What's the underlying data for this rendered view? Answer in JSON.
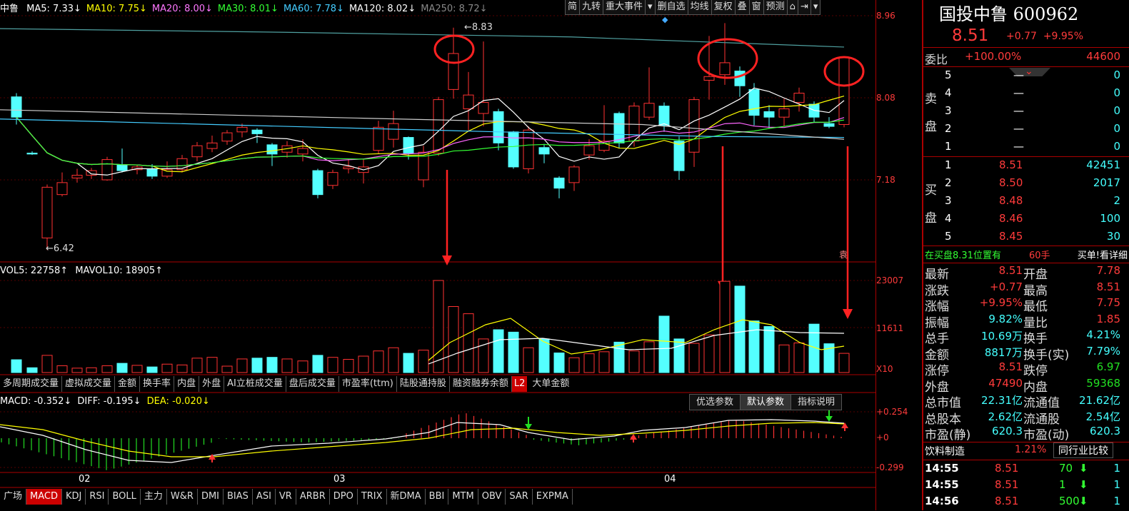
{
  "ma_legend": {
    "stock_prefix": "中鲁",
    "items": [
      {
        "text": "MA5: 7.33↓",
        "color": "#ffffff"
      },
      {
        "text": "MA10: 7.75↓",
        "color": "#ffff00"
      },
      {
        "text": "MA20: 8.00↓",
        "color": "#ff77ff"
      },
      {
        "text": "MA30: 8.01↓",
        "color": "#33ff33"
      },
      {
        "text": "MA60: 7.78↓",
        "color": "#44ccff"
      },
      {
        "text": "MA120: 8.02↓",
        "color": "#ffffff"
      },
      {
        "text": "MA250: 8.72↓",
        "color": "#888888"
      }
    ]
  },
  "toolbar": {
    "jian": "简",
    "jiuzhuan": "九转",
    "events": "重大事件",
    "dropdown": "▾",
    "del_fav": "删自选",
    "ma_line": "均线",
    "fuquan": "复权",
    "overlay": "叠",
    "window": "窗",
    "forecast": "预测",
    "lock": "🔒",
    "exit": "⇥",
    "more": "▾"
  },
  "price_axis": [
    "8.96",
    "8.08",
    "7.18"
  ],
  "price_annotations": {
    "high": "8.83",
    "low": "6.42"
  },
  "vol_legend": {
    "vol5": "VOL5: 22758↑",
    "mavol10": "MAVOL10: 18905↑"
  },
  "vol_axis": [
    "23007",
    "11611",
    "X10"
  ],
  "indicator_tabs": [
    "多周期成交量",
    "虚拟成交量",
    "金额",
    "换手率",
    "内盘",
    "外盘",
    "AI立桩成交量",
    "盘后成交量",
    "市盈率(ttm)",
    "陆股通持股",
    "融资融券余额"
  ],
  "l2_badge": "L2",
  "big_order_tab": "大单金额",
  "param_buttons": [
    "优选参数",
    "默认参数",
    "指标说明"
  ],
  "macd_legend": {
    "macd": "MACD: -0.352↓",
    "diff": "DIFF: -0.195↓",
    "dea": "DEA: -0.020↓"
  },
  "macd_axis": [
    "+0.254",
    "+0",
    "-0.299"
  ],
  "month_labels": [
    "02",
    "03",
    "04"
  ],
  "bottom_tabs": [
    "广场",
    "MACD",
    "KDJ",
    "RSI",
    "BOLL",
    "主力",
    "W&R",
    "DMI",
    "BIAS",
    "ASI",
    "VR",
    "ARBR",
    "DPO",
    "TRIX",
    "新DMA",
    "BBI",
    "MTM",
    "OBV",
    "SAR",
    "EXPMA"
  ],
  "vol_marker": "袁",
  "panel": {
    "name": "国投中鲁",
    "code": "600962",
    "price": "8.51",
    "change": "+0.77",
    "change_pct": "+9.95%",
    "weibi_label": "委比",
    "weibi_value": "+100.00%",
    "weibi_diff": "44600",
    "sell_label_1": "卖",
    "sell_label_2": "盘",
    "buy_label_1": "买",
    "buy_label_2": "盘",
    "sell": [
      {
        "lvl": "5",
        "price": "—",
        "vol": "0"
      },
      {
        "lvl": "4",
        "price": "—",
        "vol": "0"
      },
      {
        "lvl": "3",
        "price": "—",
        "vol": "0"
      },
      {
        "lvl": "2",
        "price": "—",
        "vol": "0"
      },
      {
        "lvl": "1",
        "price": "—",
        "vol": "0"
      }
    ],
    "buy": [
      {
        "lvl": "1",
        "price": "8.51",
        "vol": "42451"
      },
      {
        "lvl": "2",
        "price": "8.50",
        "vol": "2017"
      },
      {
        "lvl": "3",
        "price": "8.48",
        "vol": "2"
      },
      {
        "lvl": "4",
        "price": "8.46",
        "vol": "100"
      },
      {
        "lvl": "5",
        "price": "8.45",
        "vol": "30"
      }
    ],
    "position_note": "在买盘8.31位置有",
    "position_hands": "60手",
    "position_link": "买单!看详细",
    "stats": [
      {
        "l1": "最新",
        "v1": "8.51",
        "c1": "#ff3b3b",
        "l2": "开盘",
        "v2": "7.78",
        "c2": "#ff3b3b"
      },
      {
        "l1": "涨跌",
        "v1": "+0.77",
        "c1": "#ff3b3b",
        "l2": "最高",
        "v2": "8.51",
        "c2": "#ff3b3b"
      },
      {
        "l1": "涨幅",
        "v1": "+9.95%",
        "c1": "#ff3b3b",
        "l2": "最低",
        "v2": "7.75",
        "c2": "#ff3b3b"
      },
      {
        "l1": "振幅",
        "v1": "9.82%",
        "c1": "#44ffff",
        "l2": "量比",
        "v2": "1.85",
        "c2": "#ff3b3b"
      },
      {
        "l1": "总手",
        "v1": "10.69万",
        "c1": "#44ffff",
        "l2": "换手",
        "v2": "4.21%",
        "c2": "#44ffff"
      },
      {
        "l1": "金额",
        "v1": "8817万",
        "c1": "#44ffff",
        "l2": "换手(实)",
        "v2": "7.79%",
        "c2": "#44ffff"
      },
      {
        "l1": "涨停",
        "v1": "8.51",
        "c1": "#ff3b3b",
        "l2": "跌停",
        "v2": "6.97",
        "c2": "#22e022"
      },
      {
        "l1": "外盘",
        "v1": "47490",
        "c1": "#ff3b3b",
        "l2": "内盘",
        "v2": "59368",
        "c2": "#22e022"
      },
      {
        "l1": "总市值",
        "v1": "22.31亿",
        "c1": "#44ffff",
        "l2": "流通值",
        "v2": "21.62亿",
        "c2": "#44ffff"
      },
      {
        "l1": "总股本",
        "v1": "2.62亿",
        "c1": "#44ffff",
        "l2": "流通股",
        "v2": "2.54亿",
        "c2": "#44ffff"
      },
      {
        "l1": "市盈(静)",
        "v1": "620.3",
        "c1": "#44ffff",
        "l2": "市盈(动)",
        "v2": "620.3",
        "c2": "#44ffff"
      }
    ],
    "industry": "饮料制造",
    "industry_pct": "1.21%",
    "industry_btn": "同行业比较",
    "ticks": [
      {
        "time": "14:55",
        "price": "8.51",
        "vol": "70",
        "n": "1"
      },
      {
        "time": "14:55",
        "price": "8.51",
        "vol": "1",
        "n": "1"
      },
      {
        "time": "14:56",
        "price": "8.51",
        "vol": "500",
        "n": "1"
      }
    ]
  }
}
